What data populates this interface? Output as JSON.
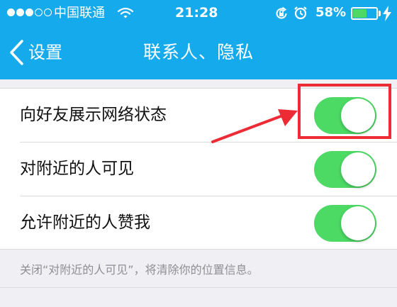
{
  "status_bar": {
    "carrier": "中国联通",
    "time": "21:28",
    "battery_percent": "58%",
    "battery_level": 0.58,
    "signal_bars_filled": 3,
    "signal_bars_total": 5,
    "icons": [
      "wifi-icon",
      "rotation-lock-icon",
      "alarm-icon",
      "battery-icon",
      "charging-bolt-icon"
    ]
  },
  "nav": {
    "back_label": "设置",
    "title": "联系人、隐私"
  },
  "settings": {
    "rows": [
      {
        "label": "向好友展示网络状态",
        "enabled": true
      },
      {
        "label": "对附近的人可见",
        "enabled": true
      },
      {
        "label": "允许附近的人赞我",
        "enabled": true
      }
    ],
    "footer_note": "关闭“对附近的人可见”，将清除你的位置信息。"
  },
  "colors": {
    "nav_background": "#15aaec",
    "toggle_on": "#4cd964",
    "annotation": "#ec2b35",
    "page_background": "#efeff4"
  }
}
